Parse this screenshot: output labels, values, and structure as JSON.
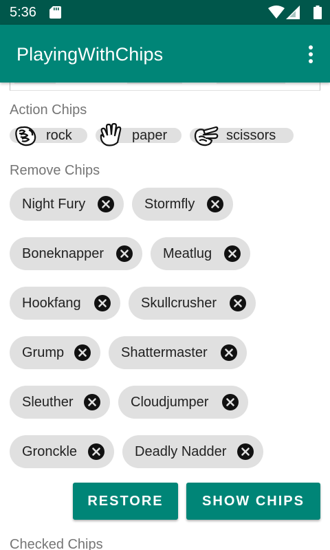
{
  "status_bar": {
    "time": "5:36",
    "icons": [
      "sd-card-icon",
      "wifi-icon",
      "signal-icon",
      "battery-icon"
    ]
  },
  "app_bar": {
    "title": "PlayingWithChips",
    "menu_icon": "more-vert-icon"
  },
  "sections": {
    "action_title": "Action Chips",
    "remove_title": "Remove Chips",
    "checked_title": "Checked Chips"
  },
  "action_chips": [
    {
      "label": "rock",
      "icon": "rock-hand-icon"
    },
    {
      "label": "paper",
      "icon": "paper-hand-icon"
    },
    {
      "label": "scissors",
      "icon": "scissors-hand-icon"
    }
  ],
  "remove_chips": [
    "Night Fury",
    "Stormfly",
    "Boneknapper",
    "Meatlug",
    "Hookfang",
    "Skullcrusher",
    "Grump",
    "Shattermaster",
    "Sleuther",
    "Cloudjumper",
    "Gronckle",
    "Deadly Nadder"
  ],
  "buttons": {
    "restore": "RESTORE",
    "show_chips": "SHOW CHIPS"
  },
  "colors": {
    "status_bar": "#00574b",
    "primary": "#008577",
    "chip_bg": "#e0e0e0",
    "section_text": "#757575"
  }
}
